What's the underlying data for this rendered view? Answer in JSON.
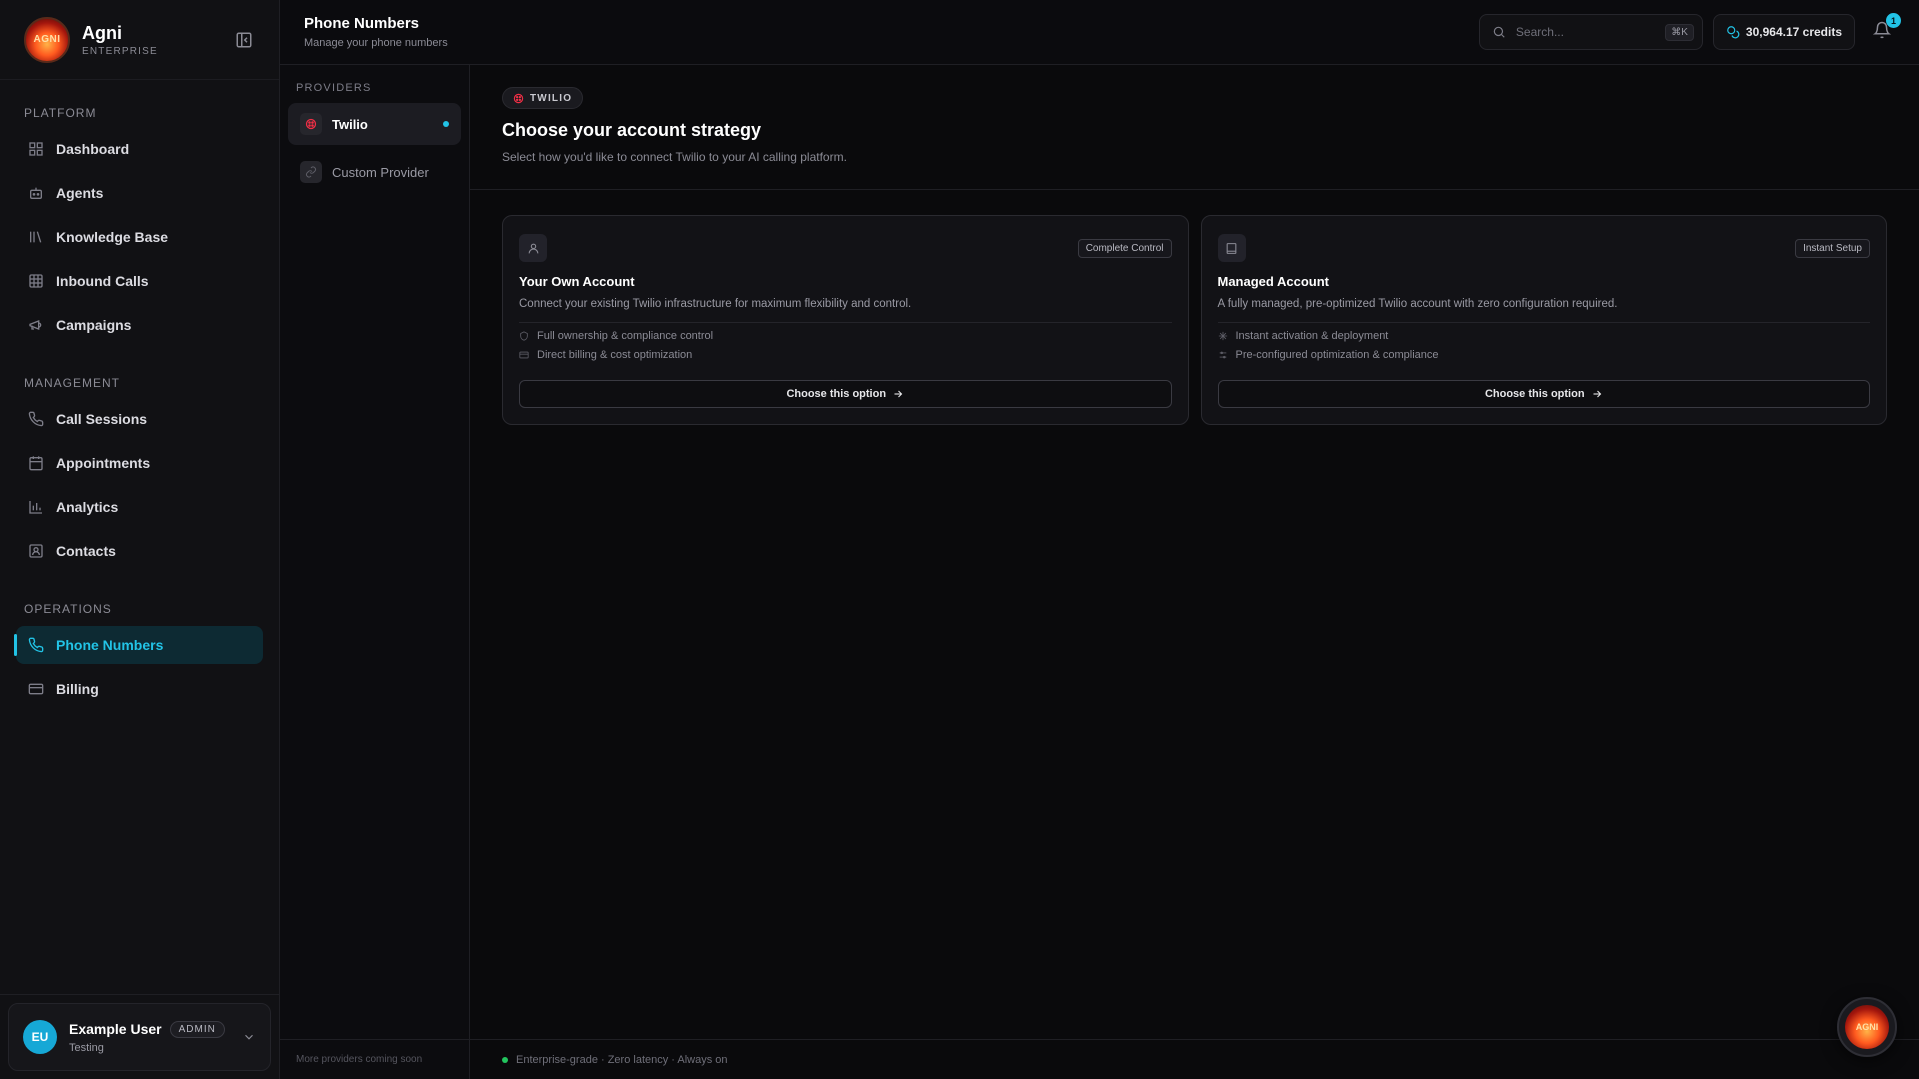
{
  "brand": {
    "name": "Agni",
    "tier": "ENTERPRISE",
    "logo_text": "AGNI"
  },
  "sidebar": {
    "sections": [
      {
        "title": "PLATFORM",
        "items": [
          {
            "label": "Dashboard",
            "icon": "dashboard-icon"
          },
          {
            "label": "Agents",
            "icon": "bot-icon"
          },
          {
            "label": "Knowledge Base",
            "icon": "library-icon"
          },
          {
            "label": "Inbound Calls",
            "icon": "grid-icon"
          },
          {
            "label": "Campaigns",
            "icon": "megaphone-icon"
          }
        ]
      },
      {
        "title": "MANAGEMENT",
        "items": [
          {
            "label": "Call Sessions",
            "icon": "phone-icon"
          },
          {
            "label": "Appointments",
            "icon": "calendar-icon"
          },
          {
            "label": "Analytics",
            "icon": "bar-chart-icon"
          },
          {
            "label": "Contacts",
            "icon": "contact-icon"
          }
        ]
      },
      {
        "title": "OPERATIONS",
        "items": [
          {
            "label": "Phone Numbers",
            "icon": "phone-icon",
            "active": true
          },
          {
            "label": "Billing",
            "icon": "credit-card-icon"
          }
        ]
      }
    ]
  },
  "user": {
    "initials": "EU",
    "name": "Example User",
    "role": "ADMIN",
    "subtitle": "Testing"
  },
  "header": {
    "title": "Phone Numbers",
    "subtitle": "Manage your phone numbers",
    "search_placeholder": "Search...",
    "search_shortcut": "⌘K",
    "credits": "30,964.17 credits",
    "notification_count": "1"
  },
  "providers": {
    "title": "PROVIDERS",
    "items": [
      {
        "label": "Twilio",
        "active": true
      },
      {
        "label": "Custom Provider",
        "active": false
      }
    ],
    "footer": "More providers coming soon"
  },
  "main": {
    "pill": "TWILIO",
    "title": "Choose your account strategy",
    "subtitle": "Select how you'd like to connect Twilio to your AI calling platform.",
    "cards": [
      {
        "tag": "Complete Control",
        "title": "Your Own Account",
        "desc": "Connect your existing Twilio infrastructure for maximum flexibility and control.",
        "features": [
          "Full ownership & compliance control",
          "Direct billing & cost optimization"
        ],
        "button": "Choose this option"
      },
      {
        "tag": "Instant Setup",
        "title": "Managed Account",
        "desc": "A fully managed, pre-optimized Twilio account with zero configuration required.",
        "features": [
          "Instant activation & deployment",
          "Pre-configured optimization & compliance"
        ],
        "button": "Choose this option"
      }
    ],
    "footer": "Enterprise-grade · Zero latency · Always on"
  },
  "colors": {
    "accent": "#22c3e6",
    "twilio": "#f22f46",
    "status_ok": "#22c55e"
  }
}
